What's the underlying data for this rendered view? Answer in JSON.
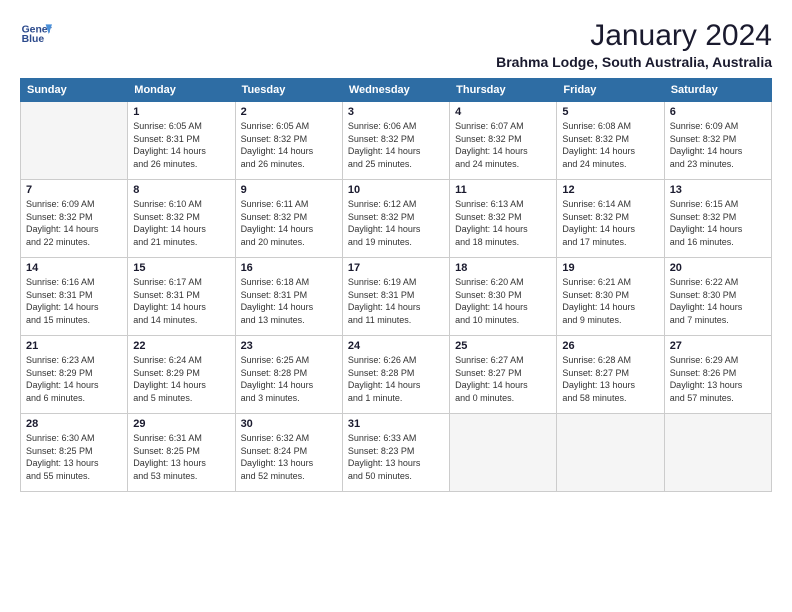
{
  "logo": {
    "line1": "General",
    "line2": "Blue"
  },
  "title": "January 2024",
  "subtitle": "Brahma Lodge, South Australia, Australia",
  "header_days": [
    "Sunday",
    "Monday",
    "Tuesday",
    "Wednesday",
    "Thursday",
    "Friday",
    "Saturday"
  ],
  "weeks": [
    [
      {
        "day": "",
        "info": ""
      },
      {
        "day": "1",
        "info": "Sunrise: 6:05 AM\nSunset: 8:31 PM\nDaylight: 14 hours\nand 26 minutes."
      },
      {
        "day": "2",
        "info": "Sunrise: 6:05 AM\nSunset: 8:32 PM\nDaylight: 14 hours\nand 26 minutes."
      },
      {
        "day": "3",
        "info": "Sunrise: 6:06 AM\nSunset: 8:32 PM\nDaylight: 14 hours\nand 25 minutes."
      },
      {
        "day": "4",
        "info": "Sunrise: 6:07 AM\nSunset: 8:32 PM\nDaylight: 14 hours\nand 24 minutes."
      },
      {
        "day": "5",
        "info": "Sunrise: 6:08 AM\nSunset: 8:32 PM\nDaylight: 14 hours\nand 24 minutes."
      },
      {
        "day": "6",
        "info": "Sunrise: 6:09 AM\nSunset: 8:32 PM\nDaylight: 14 hours\nand 23 minutes."
      }
    ],
    [
      {
        "day": "7",
        "info": "Sunrise: 6:09 AM\nSunset: 8:32 PM\nDaylight: 14 hours\nand 22 minutes."
      },
      {
        "day": "8",
        "info": "Sunrise: 6:10 AM\nSunset: 8:32 PM\nDaylight: 14 hours\nand 21 minutes."
      },
      {
        "day": "9",
        "info": "Sunrise: 6:11 AM\nSunset: 8:32 PM\nDaylight: 14 hours\nand 20 minutes."
      },
      {
        "day": "10",
        "info": "Sunrise: 6:12 AM\nSunset: 8:32 PM\nDaylight: 14 hours\nand 19 minutes."
      },
      {
        "day": "11",
        "info": "Sunrise: 6:13 AM\nSunset: 8:32 PM\nDaylight: 14 hours\nand 18 minutes."
      },
      {
        "day": "12",
        "info": "Sunrise: 6:14 AM\nSunset: 8:32 PM\nDaylight: 14 hours\nand 17 minutes."
      },
      {
        "day": "13",
        "info": "Sunrise: 6:15 AM\nSunset: 8:32 PM\nDaylight: 14 hours\nand 16 minutes."
      }
    ],
    [
      {
        "day": "14",
        "info": "Sunrise: 6:16 AM\nSunset: 8:31 PM\nDaylight: 14 hours\nand 15 minutes."
      },
      {
        "day": "15",
        "info": "Sunrise: 6:17 AM\nSunset: 8:31 PM\nDaylight: 14 hours\nand 14 minutes."
      },
      {
        "day": "16",
        "info": "Sunrise: 6:18 AM\nSunset: 8:31 PM\nDaylight: 14 hours\nand 13 minutes."
      },
      {
        "day": "17",
        "info": "Sunrise: 6:19 AM\nSunset: 8:31 PM\nDaylight: 14 hours\nand 11 minutes."
      },
      {
        "day": "18",
        "info": "Sunrise: 6:20 AM\nSunset: 8:30 PM\nDaylight: 14 hours\nand 10 minutes."
      },
      {
        "day": "19",
        "info": "Sunrise: 6:21 AM\nSunset: 8:30 PM\nDaylight: 14 hours\nand 9 minutes."
      },
      {
        "day": "20",
        "info": "Sunrise: 6:22 AM\nSunset: 8:30 PM\nDaylight: 14 hours\nand 7 minutes."
      }
    ],
    [
      {
        "day": "21",
        "info": "Sunrise: 6:23 AM\nSunset: 8:29 PM\nDaylight: 14 hours\nand 6 minutes."
      },
      {
        "day": "22",
        "info": "Sunrise: 6:24 AM\nSunset: 8:29 PM\nDaylight: 14 hours\nand 5 minutes."
      },
      {
        "day": "23",
        "info": "Sunrise: 6:25 AM\nSunset: 8:28 PM\nDaylight: 14 hours\nand 3 minutes."
      },
      {
        "day": "24",
        "info": "Sunrise: 6:26 AM\nSunset: 8:28 PM\nDaylight: 14 hours\nand 1 minute."
      },
      {
        "day": "25",
        "info": "Sunrise: 6:27 AM\nSunset: 8:27 PM\nDaylight: 14 hours\nand 0 minutes."
      },
      {
        "day": "26",
        "info": "Sunrise: 6:28 AM\nSunset: 8:27 PM\nDaylight: 13 hours\nand 58 minutes."
      },
      {
        "day": "27",
        "info": "Sunrise: 6:29 AM\nSunset: 8:26 PM\nDaylight: 13 hours\nand 57 minutes."
      }
    ],
    [
      {
        "day": "28",
        "info": "Sunrise: 6:30 AM\nSunset: 8:25 PM\nDaylight: 13 hours\nand 55 minutes."
      },
      {
        "day": "29",
        "info": "Sunrise: 6:31 AM\nSunset: 8:25 PM\nDaylight: 13 hours\nand 53 minutes."
      },
      {
        "day": "30",
        "info": "Sunrise: 6:32 AM\nSunset: 8:24 PM\nDaylight: 13 hours\nand 52 minutes."
      },
      {
        "day": "31",
        "info": "Sunrise: 6:33 AM\nSunset: 8:23 PM\nDaylight: 13 hours\nand 50 minutes."
      },
      {
        "day": "",
        "info": ""
      },
      {
        "day": "",
        "info": ""
      },
      {
        "day": "",
        "info": ""
      }
    ]
  ]
}
